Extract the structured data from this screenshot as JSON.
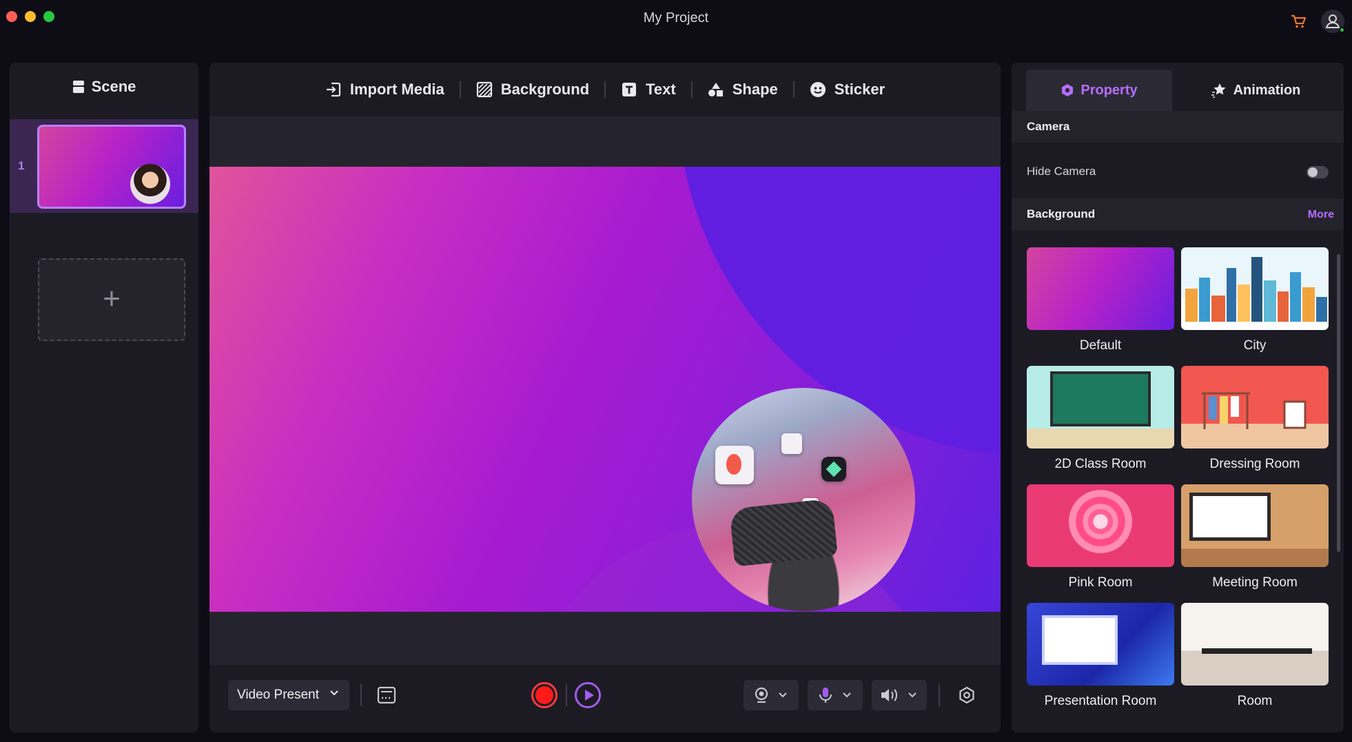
{
  "window": {
    "title": "My Project"
  },
  "colors": {
    "accent": "#b66dff",
    "record": "#ff1a1a",
    "online": "#27c13f",
    "cart": "#f0782c"
  },
  "scene": {
    "header": "Scene",
    "items": [
      {
        "number": "1"
      }
    ],
    "add_icon": "+"
  },
  "toolbar": {
    "items": [
      {
        "label": "Import Media",
        "icon": "import-icon"
      },
      {
        "label": "Background",
        "icon": "background-icon"
      },
      {
        "label": "Text",
        "icon": "text-icon"
      },
      {
        "label": "Shape",
        "icon": "shape-icon"
      },
      {
        "label": "Sticker",
        "icon": "sticker-icon"
      }
    ]
  },
  "bottom_bar": {
    "mode": "Video Present",
    "controls": [
      "teleprompter-icon",
      "record-button",
      "play-button",
      "webcam-icon",
      "microphone-icon",
      "speaker-icon",
      "settings-icon"
    ]
  },
  "right_panel": {
    "tabs": [
      {
        "label": "Property",
        "active": true
      },
      {
        "label": "Animation",
        "active": false
      }
    ],
    "camera": {
      "title": "Camera",
      "hide_label": "Hide Camera",
      "hide_enabled": false
    },
    "background": {
      "title": "Background",
      "more": "More",
      "items": [
        {
          "label": "Default"
        },
        {
          "label": "City"
        },
        {
          "label": "2D Class Room"
        },
        {
          "label": "Dressing Room"
        },
        {
          "label": "Pink Room"
        },
        {
          "label": "Meeting Room"
        },
        {
          "label": "Presentation Room"
        },
        {
          "label": "Room"
        }
      ]
    }
  }
}
